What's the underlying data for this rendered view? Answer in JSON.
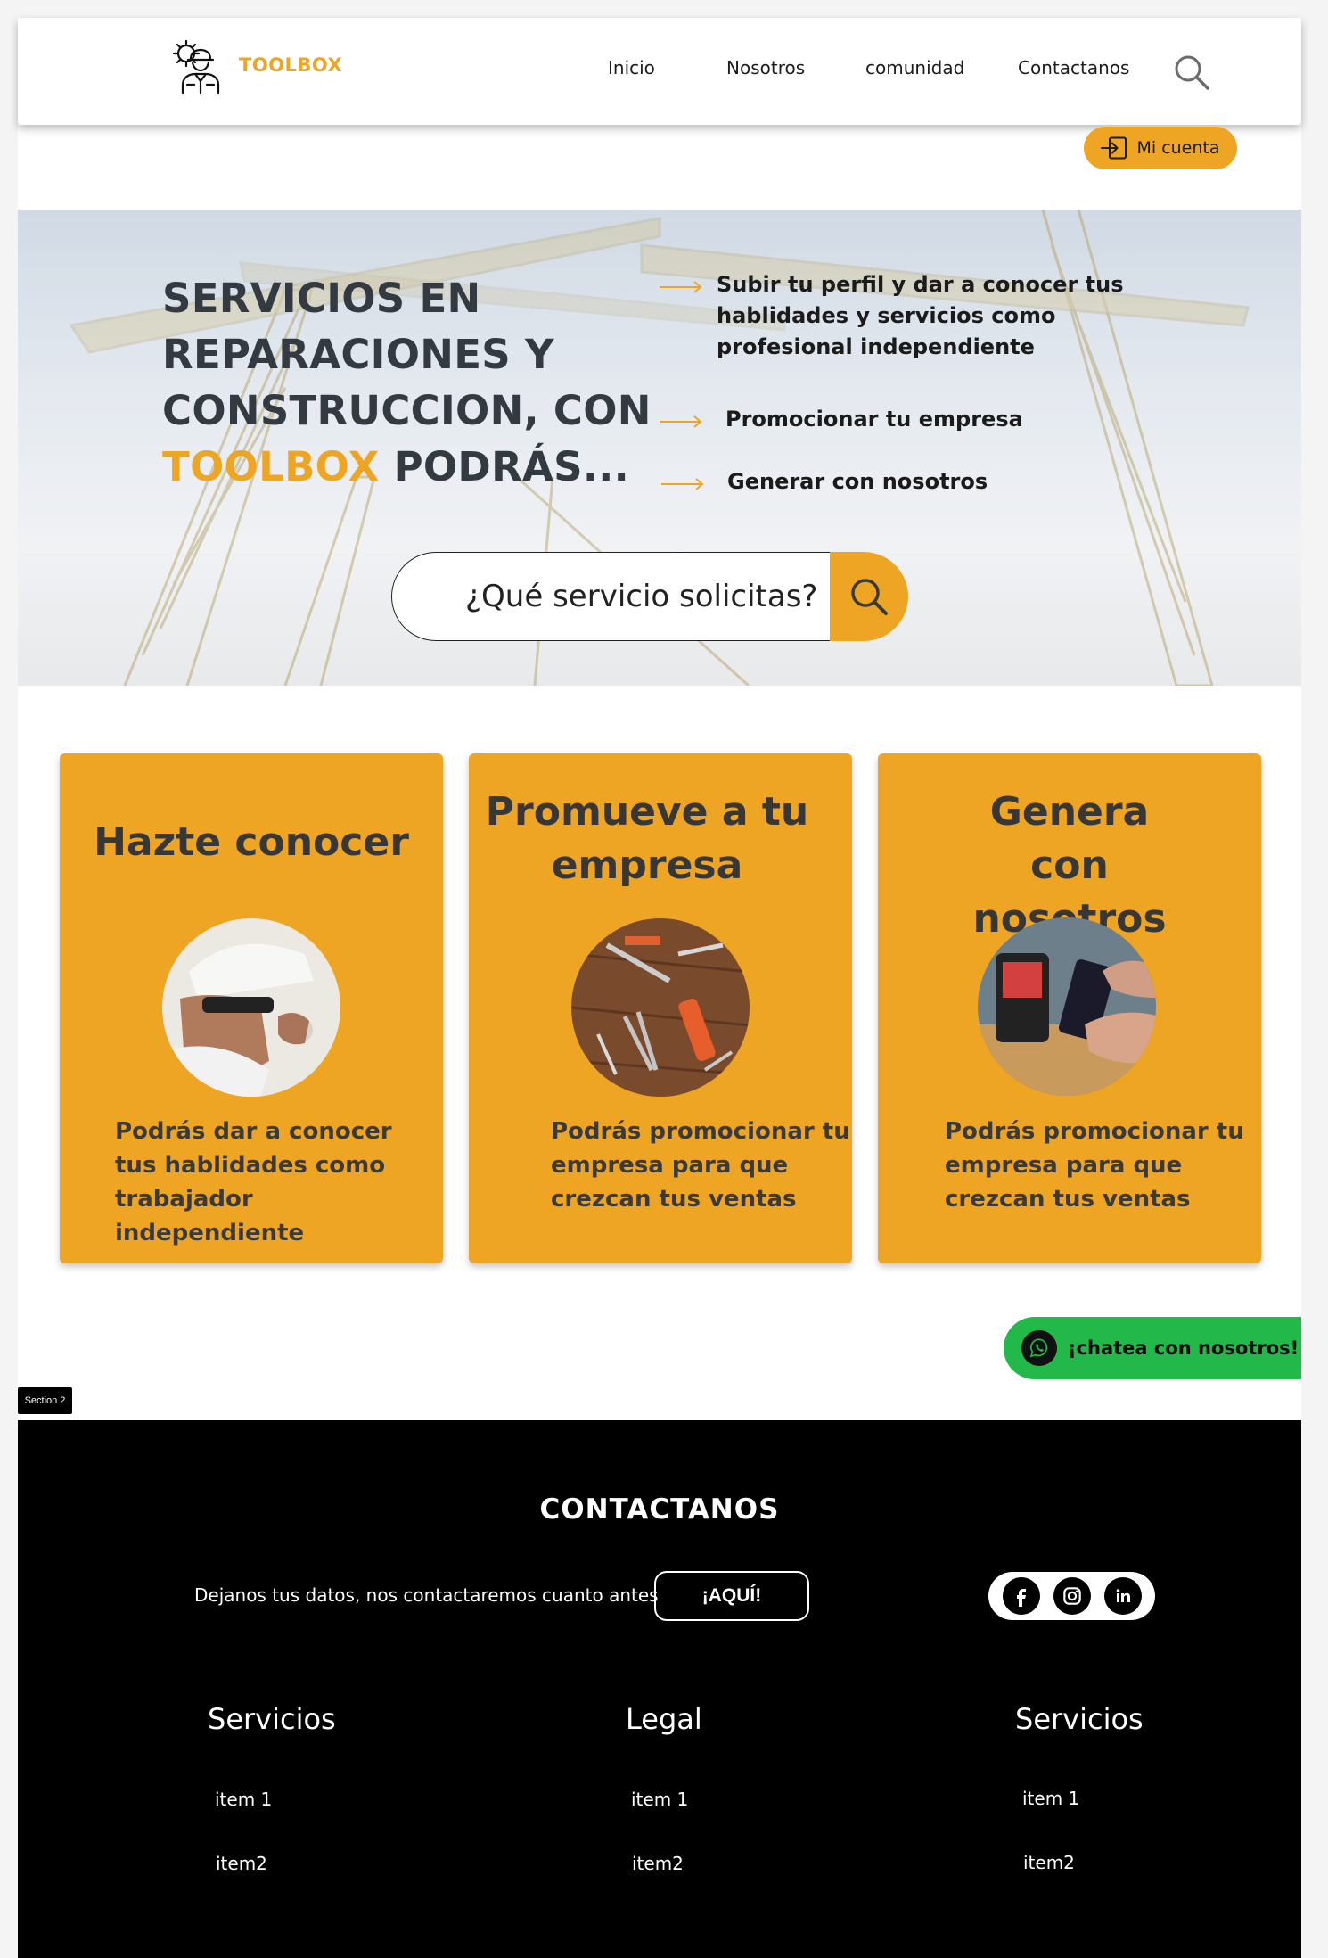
{
  "header": {
    "brand": "TOOLBOX",
    "nav": [
      "Inicio",
      "Nosotros",
      "comunidad",
      "Contactanos"
    ],
    "account_label": "Mi cuenta"
  },
  "hero": {
    "title_lines": [
      "SERVICIOS EN",
      "REPARACIONES Y",
      "CONSTRUCCION, CON"
    ],
    "title_accent": "TOOLBOX",
    "title_end": " PODRÁS...",
    "benefits": [
      "Subir tu perfil y dar a conocer tus hablidades y servicios como profesional independiente",
      "Promocionar tu empresa",
      "Generar con nosotros"
    ],
    "search_placeholder": "¿Qué servicio solicitas?"
  },
  "cards": [
    {
      "title": "Hazte conocer",
      "text": "Podrás dar a conocer tus hablidades como trabajador independiente"
    },
    {
      "title": "Promueve a tu empresa",
      "text": "Podrás promocionar tu empresa para que crezcan tus ventas"
    },
    {
      "title": "Genera con nosotros",
      "text": "Podrás promocionar tu empresa para que crezcan tus ventas"
    }
  ],
  "chat": {
    "label": "¡chatea con nosotros!"
  },
  "section_tag": "Section 2",
  "footer": {
    "title": "CONTACTANOS",
    "note": "Dejanos tus datos, nos contactaremos cuanto antes",
    "button": "¡AQUÍ!",
    "columns": [
      {
        "title": "Servicios",
        "items": [
          "item 1",
          "item2"
        ]
      },
      {
        "title": "Legal",
        "items": [
          "item 1",
          "item2"
        ]
      },
      {
        "title": "Servicios",
        "items": [
          "item 1",
          "item2"
        ]
      }
    ]
  },
  "colors": {
    "accent": "#efa524",
    "chat": "#22b84a",
    "footer": "#000000"
  }
}
